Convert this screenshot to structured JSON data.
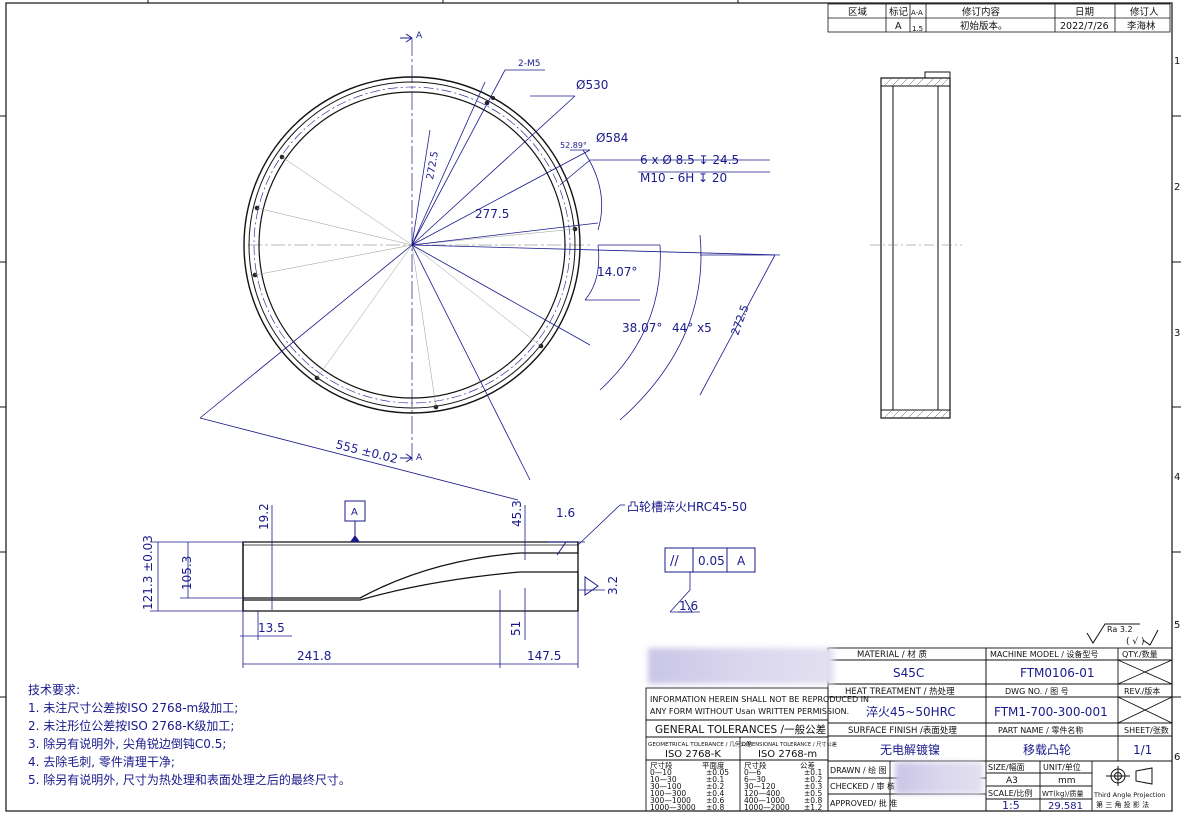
{
  "colors": {
    "line": "#111111",
    "dim": "#1a1a8c",
    "bg": "#ffffff",
    "blur": "#cfcbe8"
  },
  "revision_table": {
    "headers": [
      "区域",
      "标记",
      "A-A",
      "修订内容",
      "日期",
      "修订人"
    ],
    "row": {
      "zone": "",
      "mark": "A",
      "ref": "1.5",
      "content": "初始版本。",
      "date": "2022/7/26",
      "author": "李海林"
    }
  },
  "view_labels": {
    "section_top": "A",
    "section_bottom": "A",
    "datum": "A"
  },
  "dimensions_front": {
    "thread_small": "2-M5",
    "dia_inner": "Ø530",
    "dia_outer": "Ø584",
    "angle_small": "52.89°",
    "holes_line1": "6 x Ø 8.5 ↧ 24.5",
    "holes_line2": "M10 - 6H ↧ 20",
    "radius_a": "272.5",
    "radius_b": "277.5",
    "angle_1": "14.07°",
    "angle_2": "38.07°",
    "angle_3": "44° x5",
    "radius_c": "272.5",
    "total_span": "555 ±0.02"
  },
  "dimensions_section": {
    "h_19": "19.2",
    "h_45": "45.3",
    "h_121": "121.3 ±0.03",
    "h_105": "105.3",
    "h_13": "13.5",
    "h_51": "51",
    "w_241": "241.8",
    "w_147": "147.5",
    "rough_top": "1.6",
    "rough_side": "3.2",
    "rough_bottom": "1.6",
    "note_hardening": "凸轮槽淬火HRC45-50",
    "tolerance_symbol": "//",
    "tolerance_value": "0.05",
    "tolerance_datum": "A"
  },
  "surface_mark": {
    "rough": "Ra 3.2",
    "check": "( √ )"
  },
  "tech_requirements": {
    "title": "技术要求:",
    "items": [
      "1.   未注尺寸公差按ISO 2768-m级加工;",
      "2.   未注形位公差按ISO 2768-K级加工;",
      "3.   除另有说明外, 尖角锐边倒钝C0.5;",
      "4.   去除毛刺, 零件清理干净;",
      "5.   除另有说明外, 尺寸为热处理和表面处理之后的最终尺寸。"
    ]
  },
  "title_block": {
    "notice_line1": "INFORMATION HEREIN SHALL NOT BE REPRODUCED IN",
    "notice_line2": "ANY FORM WITHOUT Usan WRITTEN PERMISSION.",
    "general_tol": "GENERAL TOLERANCES /一般公差",
    "geo_tol_label": "GEOMETRICAL TOLERANCE / 几何公差",
    "geo_tol_value": "ISO 2768-K",
    "dim_tol_label": "DIMENSIONAL TOLERANCE / 尺寸公差",
    "dim_tol_value": "ISO 2768-m",
    "flat_table": {
      "headers": [
        "尺寸段",
        "平面度"
      ],
      "rows": [
        [
          "0—10",
          "±0.05"
        ],
        [
          "10—30",
          "±0.1"
        ],
        [
          "30—100",
          "±0.2"
        ],
        [
          "100—300",
          "±0.4"
        ],
        [
          "300—1000",
          "±0.6"
        ],
        [
          "1000—3000",
          "±0.8"
        ]
      ]
    },
    "dim_table": {
      "headers": [
        "尺寸段",
        "公差"
      ],
      "rows": [
        [
          "0—6",
          "±0.1"
        ],
        [
          "6—30",
          "±0.2"
        ],
        [
          "30—120",
          "±0.3"
        ],
        [
          "120—400",
          "±0.5"
        ],
        [
          "400—1000",
          "±0.8"
        ],
        [
          "1000—2000",
          "±1.2"
        ]
      ]
    },
    "material_label": "MATERIAL   /  材  质",
    "material_value": "S45C",
    "heat_label": "HEAT TREATMENT  / 热处理",
    "heat_value": "淬火45~50HRC",
    "surface_label": "SURFACE FINISH  /表面处理",
    "surface_value": "无电解镀镍",
    "drawn_label": "DRAWN  / 绘 图",
    "checked_label": "CHECKED / 审 核",
    "approved_label": "APPROVED/ 批 准",
    "machine_label": "MACHINE MODEL / 设备型号",
    "machine_value": "FTM0106-01",
    "qty_label": "QTY./数量",
    "dwg_label": "DWG NO.      / 图  号",
    "dwg_value": "FTM1-700-300-001",
    "rev_label": "REV./版本",
    "part_label": "PART NAME    / 零件名称",
    "part_value": "移载凸轮",
    "sheet_label": "SHEET/张数",
    "sheet_value": "1/1",
    "size_label": "SIZE/幅面",
    "size_value": "A3",
    "unit_label": "UNIT/单位",
    "unit_value": "mm",
    "scale_label": "SCALE/比例",
    "scale_value": "1:5",
    "weight_label": "WT(kg)/质量",
    "weight_value": "29.581",
    "projection_en": "Third Angle Projection",
    "projection_cn": "第 三 角 投 影 法"
  },
  "border_numbers": [
    "1",
    "2",
    "3",
    "4",
    "5",
    "6"
  ]
}
